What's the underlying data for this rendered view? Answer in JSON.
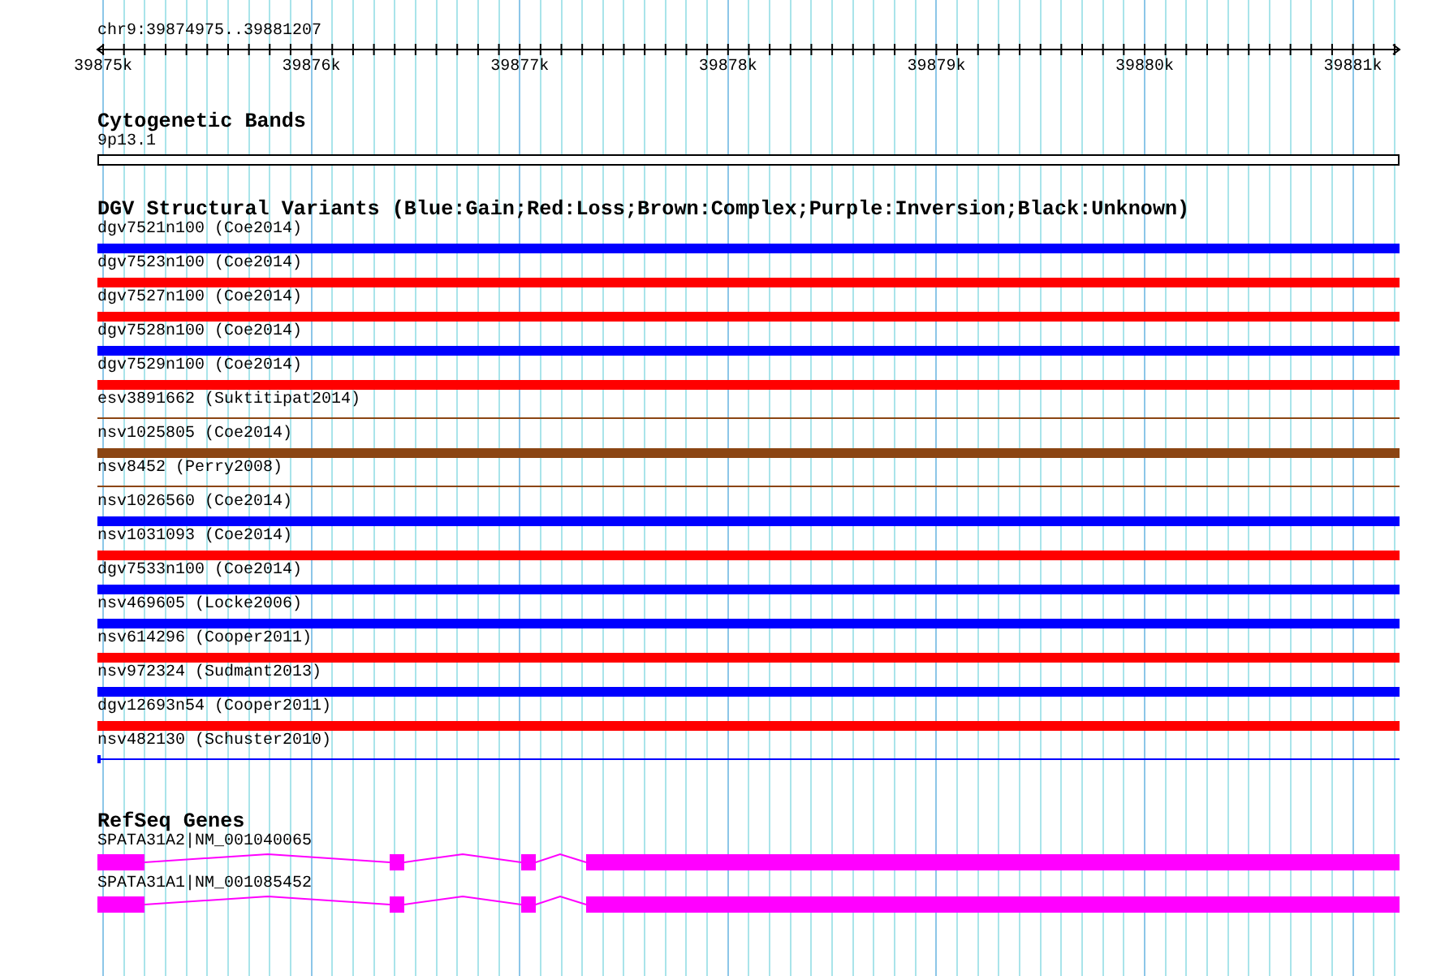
{
  "position": "chr9:39874975..39881207",
  "ruler": {
    "ticks": [
      "39875k",
      "39876k",
      "39877k",
      "39878k",
      "39879k",
      "39880k",
      "39881k"
    ]
  },
  "cytogenetic_bands": {
    "title": "Cytogenetic Bands",
    "band": "9p13.1"
  },
  "dgv": {
    "title": "DGV Structural Variants (Blue:Gain;Red:Loss;Brown:Complex;Purple:Inversion;Black:Unknown)",
    "variants": [
      {
        "label": "dgv7521n100 (Coe2014)",
        "kind": "thick",
        "color": "#0000ff"
      },
      {
        "label": "dgv7523n100 (Coe2014)",
        "kind": "thick",
        "color": "#ff0000"
      },
      {
        "label": "dgv7527n100 (Coe2014)",
        "kind": "thick",
        "color": "#ff0000"
      },
      {
        "label": "dgv7528n100 (Coe2014)",
        "kind": "thick",
        "color": "#0000ff"
      },
      {
        "label": "dgv7529n100 (Coe2014)",
        "kind": "thick",
        "color": "#ff0000"
      },
      {
        "label": "esv3891662 (Suktitipat2014)",
        "kind": "thin",
        "color": "#8b4513"
      },
      {
        "label": "nsv1025805 (Coe2014)",
        "kind": "thick",
        "color": "#8b4513"
      },
      {
        "label": "nsv8452 (Perry2008)",
        "kind": "thin",
        "color": "#8b4513"
      },
      {
        "label": "nsv1026560 (Coe2014)",
        "kind": "thick",
        "color": "#0000ff"
      },
      {
        "label": "nsv1031093 (Coe2014)",
        "kind": "thick",
        "color": "#ff0000"
      },
      {
        "label": "dgv7533n100 (Coe2014)",
        "kind": "thick",
        "color": "#0000ff"
      },
      {
        "label": "nsv469605 (Locke2006)",
        "kind": "thick",
        "color": "#0000ff"
      },
      {
        "label": "nsv614296 (Cooper2011)",
        "kind": "thick",
        "color": "#ff0000"
      },
      {
        "label": "nsv972324 (Sudmant2013)",
        "kind": "thick",
        "color": "#0000ff"
      },
      {
        "label": "dgv12693n54 (Cooper2011)",
        "kind": "thick",
        "color": "#ff0000"
      },
      {
        "label": "nsv482130 (Schuster2010)",
        "kind": "thin-capped",
        "color": "#0000ff"
      }
    ]
  },
  "refseq": {
    "title": "RefSeq Genes",
    "genes": [
      {
        "label": "SPATA31A2|NM_001040065"
      },
      {
        "label": "SPATA31A1|NM_001085452"
      }
    ]
  }
}
